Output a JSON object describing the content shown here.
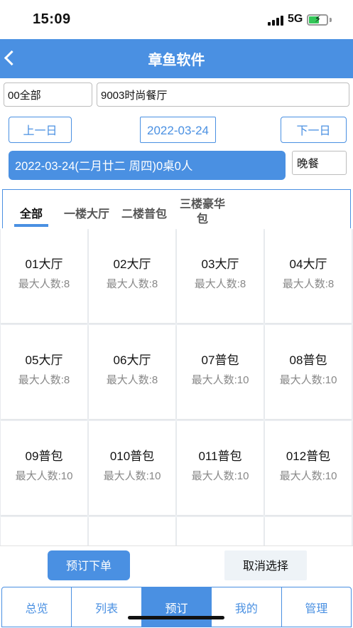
{
  "status_bar": {
    "time": "15:09",
    "network": "5G"
  },
  "header": {
    "title": "章鱼软件",
    "back_icon": "chevron-left-icon"
  },
  "filters": {
    "store": "00全部",
    "restaurant": "9003时尚餐厅"
  },
  "date_nav": {
    "prev_label": "上一日",
    "date": "2022-03-24",
    "next_label": "下一日"
  },
  "summary": {
    "text": "2022-03-24(二月廿二 周四)0桌0人",
    "meal": "晚餐"
  },
  "tabs": [
    {
      "label": "全部",
      "active": true
    },
    {
      "label": "一楼大厅"
    },
    {
      "label": "二楼普包"
    },
    {
      "label": "三楼豪华包"
    }
  ],
  "tables": [
    {
      "name": "01大厅",
      "capacity": "最大人数:8"
    },
    {
      "name": "02大厅",
      "capacity": "最大人数:8"
    },
    {
      "name": "03大厅",
      "capacity": "最大人数:8"
    },
    {
      "name": "04大厅",
      "capacity": "最大人数:8"
    },
    {
      "name": "05大厅",
      "capacity": "最大人数:8"
    },
    {
      "name": "06大厅",
      "capacity": "最大人数:8"
    },
    {
      "name": "07普包",
      "capacity": "最大人数:10"
    },
    {
      "name": "08普包",
      "capacity": "最大人数:10"
    },
    {
      "name": "09普包",
      "capacity": "最大人数:10"
    },
    {
      "name": "010普包",
      "capacity": "最大人数:10"
    },
    {
      "name": "011普包",
      "capacity": "最大人数:10"
    },
    {
      "name": "012普包",
      "capacity": "最大人数:10"
    },
    {
      "name": "",
      "capacity": ""
    },
    {
      "name": "",
      "capacity": ""
    },
    {
      "name": "",
      "capacity": ""
    },
    {
      "name": "",
      "capacity": ""
    }
  ],
  "actions": {
    "book_label": "预订下单",
    "cancel_label": "取消选择"
  },
  "bottom_nav": [
    {
      "label": "总览"
    },
    {
      "label": "列表"
    },
    {
      "label": "预订",
      "active": true
    },
    {
      "label": "我的"
    },
    {
      "label": "管理"
    }
  ],
  "colors": {
    "primary": "#4a90e2",
    "battery": "#34c759"
  }
}
